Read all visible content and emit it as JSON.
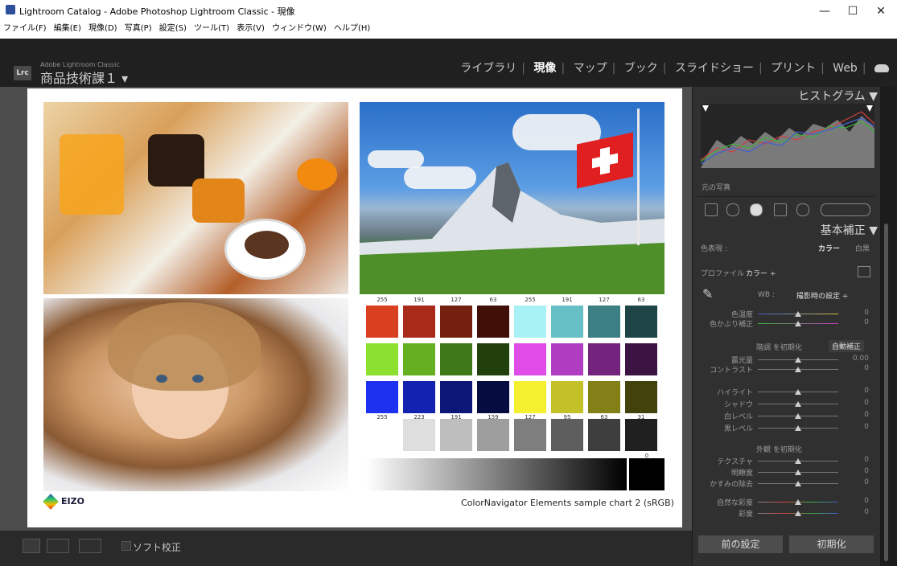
{
  "window": {
    "title": "Lightroom Catalog - Adobe Photoshop Lightroom Classic - 現像",
    "minimize": "—",
    "maximize": "☐",
    "close": "✕"
  },
  "menu": [
    "ファイル(F)",
    "編集(E)",
    "現像(D)",
    "写真(P)",
    "設定(S)",
    "ツール(T)",
    "表示(V)",
    "ウィンドウ(W)",
    "ヘルプ(H)"
  ],
  "identity": {
    "logo": "Lrc",
    "small": "Adobe Lightroom Classic",
    "name": "商品技術課１ ▾"
  },
  "modules": [
    "ライブラリ",
    "現像",
    "マップ",
    "ブック",
    "スライドショー",
    "プリント",
    "Web"
  ],
  "active_module": "現像",
  "photo": {
    "swatch_top_numbers": [
      "255",
      "191",
      "127",
      "63",
      "255",
      "191",
      "127",
      "63"
    ],
    "swatch_gray_numbers": [
      "255",
      "223",
      "191",
      "159",
      "127",
      "95",
      "63",
      "31"
    ],
    "black_number": "0",
    "brand": "EIZO",
    "caption": "ColorNavigator Elements sample chart 2  (sRGB)"
  },
  "swatches": [
    [
      "#d84020",
      "#a82a18",
      "#74200e",
      "#401008",
      "#a8f2f6",
      "#66c0c6",
      "#3c8084",
      "#1e4446"
    ],
    [
      "#8ce030",
      "#64b020",
      "#3e7818",
      "#22400c",
      "#e04ce8",
      "#b03cc0",
      "#74247c",
      "#3c1444"
    ],
    [
      "#1e30f0",
      "#1422b0",
      "#0c1676",
      "#060c40",
      "#f4f030",
      "#c4c028",
      "#848018",
      "#44420c"
    ],
    [
      "#ffffff",
      "#dedede",
      "#bebebe",
      "#9e9e9e",
      "#7e7e7e",
      "#5e5e5e",
      "#3e3e3e",
      "#202020"
    ]
  ],
  "toolbar": {
    "soft_proof": "ソフト校正"
  },
  "panels": {
    "histogram_title": "ヒストグラム ▼",
    "original_photo": "元の写真",
    "basic_title": "基本補正 ▼",
    "treatment_label": "色表現 :",
    "color": "カラー",
    "bw": "白黒",
    "profile_label": "プロファイル :",
    "profile_value": "カラー ÷",
    "wb_label": "WB :",
    "wb_value": "撮影時の設定 ÷",
    "tone_reset": "階調 を初期化",
    "auto": "自動補正",
    "presence_reset": "外観 を初期化",
    "previous": "前の設定",
    "reset": "初期化"
  },
  "sliders": {
    "wb": [
      {
        "label": "色温度",
        "value": "0"
      },
      {
        "label": "色かぶり補正",
        "value": "0"
      }
    ],
    "tone": [
      {
        "label": "露光量",
        "value": "0.00"
      },
      {
        "label": "コントラスト",
        "value": "0"
      }
    ],
    "tone2": [
      {
        "label": "ハイライト",
        "value": "0"
      },
      {
        "label": "シャドウ",
        "value": "0"
      },
      {
        "label": "白レベル",
        "value": "0"
      },
      {
        "label": "黒レベル",
        "value": "0"
      }
    ],
    "presence": [
      {
        "label": "テクスチャ",
        "value": "0"
      },
      {
        "label": "明瞭度",
        "value": "0"
      },
      {
        "label": "かすみの除去",
        "value": "0"
      }
    ],
    "saturation": [
      {
        "label": "自然な彩度",
        "value": "0"
      },
      {
        "label": "彩度",
        "value": "0"
      }
    ]
  },
  "colors": {
    "panel_bg": "#303030",
    "stage_bg": "#4d4d4d",
    "active_module": "#ffffff"
  }
}
